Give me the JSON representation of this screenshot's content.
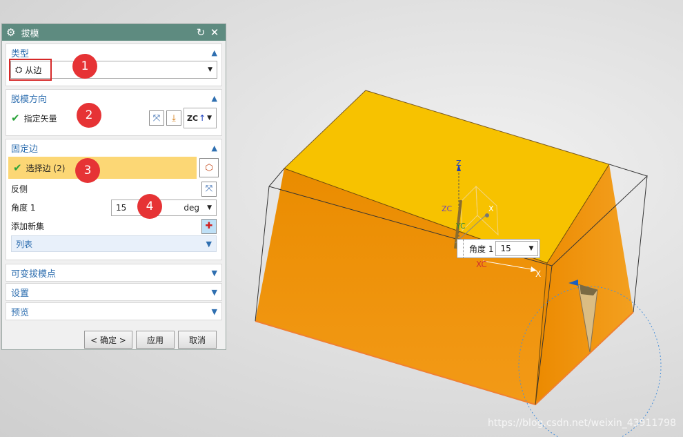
{
  "dialog": {
    "title": "拔模",
    "type_section": {
      "label": "类型",
      "selected": "从边"
    },
    "direction_section": {
      "label": "脱模方向",
      "specify_vector": "指定矢量",
      "vector_option": "ZC"
    },
    "fixed_edge_section": {
      "label": "固定边",
      "select_edge": "选择边 (2)",
      "reverse_label": "反侧",
      "angle_label": "角度 1",
      "angle_value": "15",
      "angle_unit": "deg",
      "add_new_set": "添加新集",
      "list_label": "列表"
    },
    "variable_points_label": "可变拔模点",
    "settings_label": "设置",
    "preview_label": "预览",
    "buttons": {
      "ok": "< 确定 >",
      "apply": "应用",
      "cancel": "取消"
    }
  },
  "callouts": [
    "1",
    "2",
    "3",
    "4"
  ],
  "viewport": {
    "axis_z": "Z",
    "axis_zc": "ZC",
    "axis_yc": "YC",
    "axis_xc": "XC",
    "axis_x": "X",
    "axis_x2": "X",
    "angle_popup": {
      "label": "角度 1",
      "value": "15"
    },
    "watermark": "https://blog.csdn.net/weixin_43911798"
  },
  "colors": {
    "title_bar": "#5e8b80",
    "section_header": "#2f6fb0",
    "highlight_row": "#fcd775",
    "top_face": "#f7c200",
    "side_face": "#f2950a",
    "callout": "#e63335"
  }
}
